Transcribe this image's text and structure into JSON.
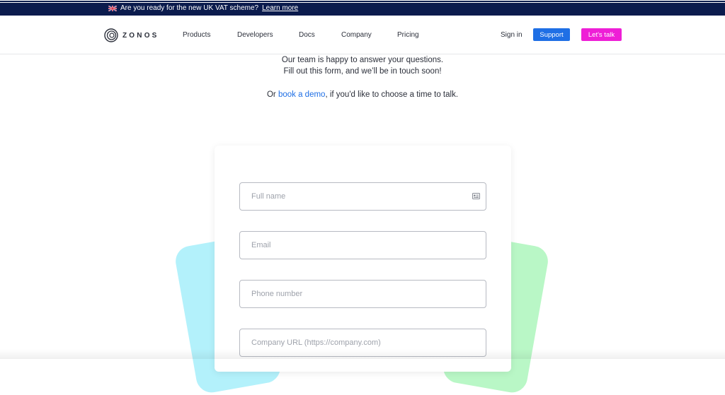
{
  "announcement": {
    "text": "Are you ready for the new UK VAT scheme?",
    "link": "Learn more",
    "flag_icon": "uk-flag-icon"
  },
  "nav": {
    "logo_text": "ZONOS",
    "links": [
      "Products",
      "Developers",
      "Docs",
      "Company",
      "Pricing"
    ],
    "sign_in": "Sign in",
    "support": "Support",
    "lets_talk": "Let's talk"
  },
  "intro": {
    "line1": "Our team is happy to answer your questions.",
    "line2": "Fill out this form, and we’ll be in touch soon!",
    "line3_prefix": "Or ",
    "line3_link": "book a demo",
    "line3_suffix": ", if you'd like to choose a time to talk."
  },
  "form": {
    "full_name_placeholder": "Full name",
    "email_placeholder": "Email",
    "phone_placeholder": "Phone number",
    "company_url_placeholder": "Company URL (https://company.com)"
  },
  "colors": {
    "announcement_bg": "#0b1b4d",
    "support_button": "#1f6fe5",
    "talk_button": "#ee1fd6",
    "card_blue": "#b3f1fb",
    "card_green": "#b9f7c6"
  }
}
